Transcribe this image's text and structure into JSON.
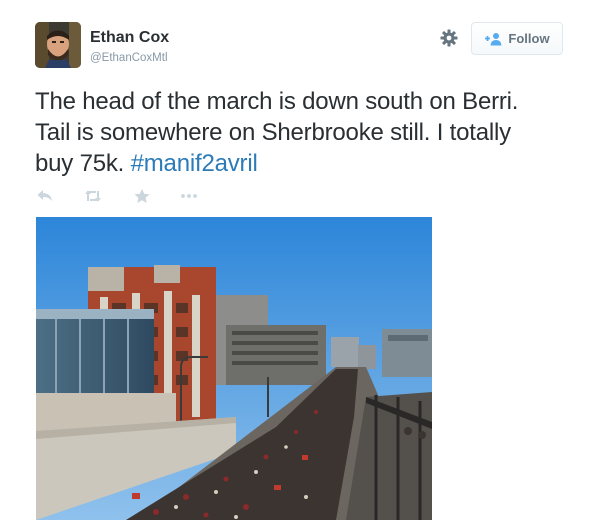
{
  "author": {
    "name": "Ethan Cox",
    "handle": "@EthanCoxMtl",
    "avatar_icon": "user-avatar-photo"
  },
  "toolbar": {
    "settings_icon": "gear-icon",
    "follow_label": "Follow",
    "follow_icon": "add-user-icon"
  },
  "tweet": {
    "text_before_hashtag": "The head of the march is  down south on Berri. Tail is somewhere on Sherbrooke still. I totally buy 75k. ",
    "hashtag": "#manif2avril",
    "hashtag_color": "#2b7bb9"
  },
  "actions": [
    {
      "name": "reply",
      "icon": "reply-icon"
    },
    {
      "name": "retweet",
      "icon": "retweet-icon"
    },
    {
      "name": "favorite",
      "icon": "star-icon"
    },
    {
      "name": "more",
      "icon": "more-icon"
    }
  ],
  "media": {
    "type": "photo",
    "icon": "march-photo"
  },
  "colors": {
    "text": "#292f33",
    "secondary": "#8899a6",
    "action_icons": "#ccd6dd",
    "link": "#2b7bb9"
  }
}
